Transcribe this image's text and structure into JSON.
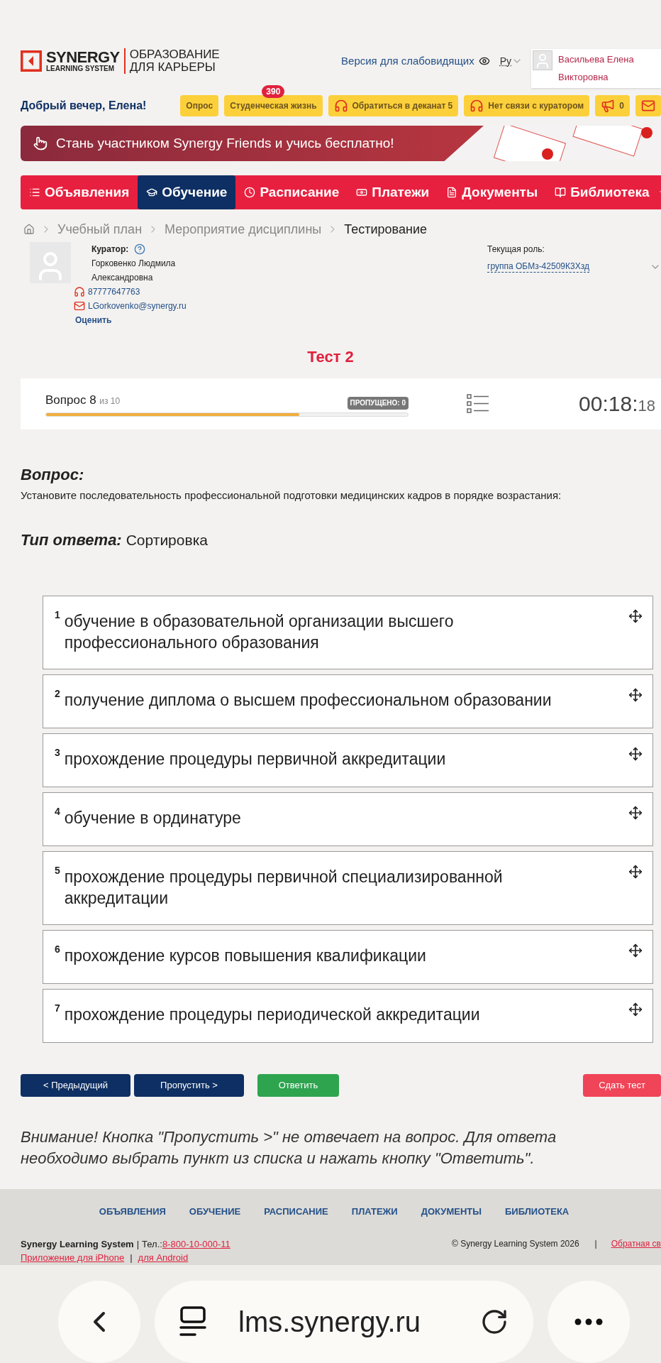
{
  "header": {
    "logo_brand": "SYNERGY",
    "logo_sub": "LEARNING SYSTEM",
    "tagline": [
      "ОБРАЗОВАНИЕ",
      "ДЛЯ КАРЬЕРЫ"
    ],
    "accessibility_link": "Версия для слабовидящих",
    "language": "Ру",
    "user_name": "Васильева Елена Викторовна"
  },
  "greeting": "Добрый вечер, Елена!",
  "quick_buttons": [
    {
      "kind": "plain",
      "label": "Опрос"
    },
    {
      "kind": "plain",
      "label": "Студенческая жизнь",
      "badge": "390"
    },
    {
      "kind": "headset",
      "label": "Обратиться в деканат 5"
    },
    {
      "kind": "headset",
      "label": "Нет связи с куратором"
    },
    {
      "kind": "megaphone",
      "label": "0"
    },
    {
      "kind": "mail"
    }
  ],
  "banner": {
    "text": "Стань участником Synergy Friends и учись бесплатно!"
  },
  "nav": [
    {
      "kind": "list",
      "label": "Объявления",
      "selected": false
    },
    {
      "kind": "cap",
      "label": "Обучение",
      "selected": true
    },
    {
      "kind": "clock",
      "label": "Расписание",
      "selected": false
    },
    {
      "kind": "money",
      "label": "Платежи",
      "selected": false
    },
    {
      "kind": "doc",
      "label": "Документы",
      "selected": false
    },
    {
      "kind": "book",
      "label": "Библиотека",
      "selected": false
    }
  ],
  "breadcrumb": [
    "Учебный план",
    "Мероприятие дисциплины",
    "Тестирование"
  ],
  "curator": {
    "label": "Куратор:",
    "name_lines": [
      "Горковенко Людмила",
      "Александровна"
    ],
    "phone": "87777647763",
    "email": "LGorkovenko@synergy.ru",
    "rate_link": "Оценить"
  },
  "role": {
    "label": "Текущая роль:",
    "value": "группа ОБМз-42509К3Хзд"
  },
  "test": {
    "title": "Тест 2",
    "question_label": "Вопрос 8",
    "question_total": "из 10",
    "skipped": "ПРОПУЩЕНО: 0",
    "level": 0.7,
    "timer": "00:18:",
    "timer_seconds": "18"
  },
  "question": {
    "heading": "Вопрос:",
    "text": "Установите последовательность профессиональной подготовки медицинских кадров в порядке возрастания:",
    "answer_type_label": "Тип ответа:",
    "answer_type": "Сортировка"
  },
  "answers": [
    {
      "number": "1",
      "text": "обучение в образовательной организации высшего профессионального образования"
    },
    {
      "number": "2",
      "text": "получение диплома о высшем профессиональном образовании"
    },
    {
      "number": "3",
      "text": "прохождение процедуры первичной аккредитации"
    },
    {
      "number": "4",
      "text": "обучение в ординатуре"
    },
    {
      "number": "5",
      "text": "прохождение процедуры первичной специализированной аккредитации"
    },
    {
      "number": "6",
      "text": "прохождение курсов повышения квалификации"
    },
    {
      "number": "7",
      "text": "прохождение процедуры периодической аккредитации"
    }
  ],
  "actions": [
    {
      "kind": "nav",
      "label": "< Предыдущий"
    },
    {
      "kind": "nav",
      "label": "Пропустить >"
    },
    {
      "kind": "answer",
      "label": "Ответить"
    },
    {
      "kind": "danger",
      "label": "Сдать тест"
    }
  ],
  "notice": "Внимание! Кнопка \"Пропустить >\" не отвечает на вопрос. Для ответа необходимо выбрать пункт из списка и нажать кнопку \"Ответить\".",
  "footer": {
    "links": [
      "ОБЪЯВЛЕНИЯ",
      "ОБУЧЕНИЕ",
      "РАСПИСАНИЕ",
      "ПЛАТЕЖИ",
      "ДОКУМЕНТЫ",
      "БИБЛИОТЕКА"
    ],
    "company": "Synergy Learning System",
    "separator": "|",
    "phone_label": "Тел.:",
    "phone": "8-800-10-000-11",
    "apps": [
      "Приложение для iPhone",
      "для Android"
    ],
    "copyright": "© Synergy Learning System 2026",
    "feedback": "Обратная св"
  },
  "browser": {
    "url": "lms.synergy.ru"
  }
}
